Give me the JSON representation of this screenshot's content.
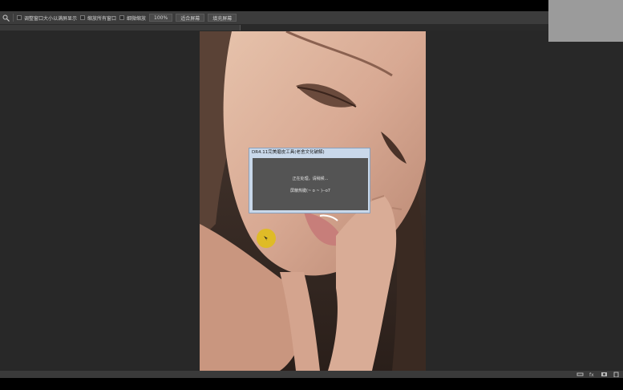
{
  "options_bar": {
    "resize_windows_label": "调整窗口大小以满屏显示",
    "zoom_all_label": "缩放所有窗口",
    "scrubby_zoom_label": "细微缩放",
    "zoom_percent": "100%",
    "fit_screen_label": "适合屏幕",
    "fill_screen_label": "填充屏幕"
  },
  "dialog": {
    "title": "DR4.11完美磨皮工具(老舍文化破解)",
    "message": "正在处理，请稍候...",
    "shortcut_hint": "屏蔽热键(~ o ~ )--o7"
  },
  "colors": {
    "workspace": "#282828",
    "options_bar": "#3c3c3c",
    "dialog_frame": "#c9d8ea",
    "dialog_body": "#545454",
    "cursor_highlight": "#e1be14"
  }
}
